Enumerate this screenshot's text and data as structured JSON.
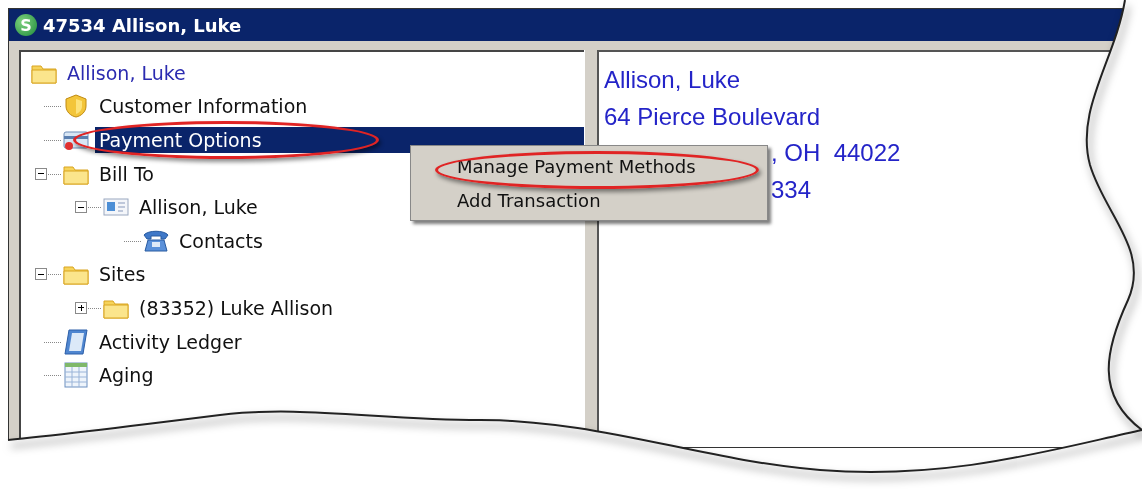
{
  "window": {
    "app_icon_letter": "S",
    "title": "47534 Allison, Luke"
  },
  "tree": [
    {
      "label": "Allison, Luke",
      "kind": "folder",
      "selected": false,
      "circled": false,
      "children": [
        {
          "label": "Customer Information",
          "kind": "shield",
          "selected": false,
          "circled": false
        },
        {
          "label": "Payment Options",
          "kind": "card",
          "selected": true,
          "circled": true
        },
        {
          "label": "Bill To",
          "kind": "folder",
          "selected": false,
          "circled": false,
          "expanded": true,
          "children": [
            {
              "label": "Allison, Luke",
              "kind": "contact",
              "selected": false,
              "circled": false,
              "expanded": true,
              "children": [
                {
                  "label": "Contacts",
                  "kind": "phone",
                  "selected": false,
                  "circled": false
                }
              ]
            }
          ]
        },
        {
          "label": "Sites",
          "kind": "folder",
          "selected": false,
          "circled": false,
          "expanded": true,
          "children": [
            {
              "label": "(83352) Luke Allison",
              "kind": "folder",
              "selected": false,
              "circled": false,
              "expanded": false
            }
          ]
        },
        {
          "label": "Activity Ledger",
          "kind": "ledger",
          "selected": false,
          "circled": false
        },
        {
          "label": "Aging",
          "kind": "table",
          "selected": false,
          "circled": false
        }
      ]
    }
  ],
  "context_menu": [
    {
      "label": "Manage Payment Methods",
      "circled": true
    },
    {
      "label": "Add Transaction",
      "circled": false
    }
  ],
  "address": [
    {
      "text": "Allison, Luke",
      "kind": "full"
    },
    {
      "text": "64 Pierce Boulevard",
      "kind": "full"
    },
    {
      "text": ", OH  44022",
      "kind": "clipped"
    },
    {
      "text": "334",
      "kind": "clipped"
    }
  ]
}
